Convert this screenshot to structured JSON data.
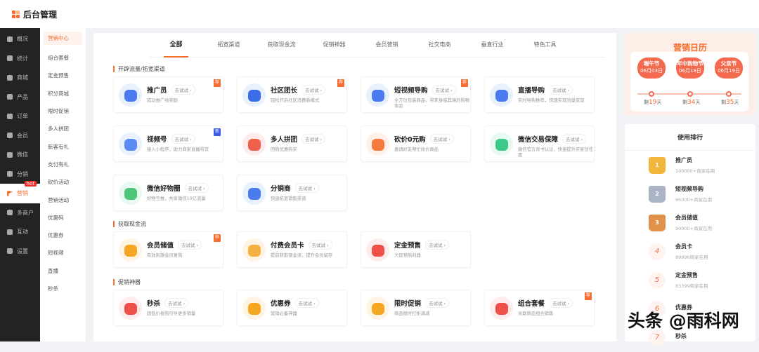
{
  "header": {
    "title": "后台管理"
  },
  "sidebar": [
    {
      "label": "概况"
    },
    {
      "label": "统计"
    },
    {
      "label": "商城"
    },
    {
      "label": "产品"
    },
    {
      "label": "订单"
    },
    {
      "label": "会员"
    },
    {
      "label": "微信"
    },
    {
      "label": "分销"
    },
    {
      "label": "营销",
      "badge": "hot"
    },
    {
      "label": "多商户"
    },
    {
      "label": "互动"
    },
    {
      "label": "设置"
    }
  ],
  "submenu": [
    "营销中心",
    "组合套餐",
    "定金预售",
    "积分商城",
    "限时促销",
    "多人拼团",
    "新客有礼",
    "支付有礼",
    "砍价活动",
    "营销活动",
    "优惠码",
    "优惠券",
    "短视频",
    "直播",
    "秒杀"
  ],
  "tabs": [
    "全部",
    "拓宽渠道",
    "获取现金流",
    "促销神器",
    "会员营销",
    "社交电商",
    "垂直行业",
    "特色工具"
  ],
  "try_label": "去试试 ›",
  "sections": [
    {
      "title": "开辟流量/拓宽渠道",
      "cards": [
        {
          "name": "推广员",
          "desc": "成功推广给奖励",
          "badge": "荐",
          "color": "#4a7cf0",
          "bg": "#eaf1fe"
        },
        {
          "name": "社区团长",
          "desc": "轻松开启社区消费新模式",
          "badge": "荐",
          "color": "#3a6ee8",
          "bg": "#eaf1fe"
        },
        {
          "name": "短视频导购",
          "desc": "全方位包装商品，带来身临其境的购物体验",
          "badge": "荐",
          "color": "#4a7cf0",
          "bg": "#eaf1fe"
        },
        {
          "name": "直播导购",
          "desc": "实时导购推荐，快速实现流量变现",
          "color": "#4a7cf0",
          "bg": "#eaf1fe"
        },
        {
          "name": "视频号",
          "desc": "接入小程序，助力商家直播带货",
          "badge": "新",
          "color": "#5b8bf5",
          "bg": "#eaf1fe"
        },
        {
          "name": "多人拼团",
          "desc": "团购优惠购买",
          "color": "#f0604a",
          "bg": "#feecec"
        },
        {
          "name": "砍价0元购",
          "desc": "邀请好友帮忙砍价商品",
          "color": "#f57a3c",
          "bg": "#fff0e8"
        },
        {
          "name": "微信交易保障",
          "desc": "微信官方背书认证，快速提升买家信任度",
          "color": "#3cc98a",
          "bg": "#e8f9f1"
        },
        {
          "name": "微信好物圈",
          "desc": "好物互推，共享微信10亿流量",
          "color": "#4cc77a",
          "bg": "#e8f9f1"
        },
        {
          "name": "分销商",
          "desc": "快速拓宽销售渠道",
          "color": "#4a7cf0",
          "bg": "#eaf1fe"
        }
      ]
    },
    {
      "title": "获取现金流",
      "cards": [
        {
          "name": "会员储值",
          "desc": "有效刺激会员复购",
          "badge": "荐",
          "color": "#f5a623",
          "bg": "#fff4e3"
        },
        {
          "name": "付费会员卡",
          "desc": "提前获取现金流，提升会员留存",
          "color": "#f5b041",
          "bg": "#fff4e3"
        },
        {
          "name": "定金预售",
          "desc": "大促预热利器",
          "color": "#f0504a",
          "bg": "#feecec"
        }
      ]
    },
    {
      "title": "促销神器",
      "cards": [
        {
          "name": "秒杀",
          "desc": "超低价抢购引导更多销量",
          "color": "#f0504a",
          "bg": "#feecec"
        },
        {
          "name": "优惠券",
          "desc": "营销必备神器",
          "color": "#f5a623",
          "bg": "#fff4e3"
        },
        {
          "name": "限时促销",
          "desc": "商品限时打折满减",
          "color": "#f5a623",
          "bg": "#fff4e3"
        },
        {
          "name": "组合套餐",
          "desc": "关联商品组合销售",
          "badge": "荐",
          "color": "#f0504a",
          "bg": "#feecec"
        }
      ]
    }
  ],
  "calendar": {
    "title": "营销日历",
    "festivals": [
      {
        "name": "端午节",
        "date": "06月03日",
        "prefix": "剩",
        "days": "19",
        "suffix": "天"
      },
      {
        "name": "年中购物节",
        "date": "06月18日",
        "prefix": "剩",
        "days": "34",
        "suffix": "天"
      },
      {
        "name": "父亲节",
        "date": "06月19日",
        "prefix": "剩",
        "days": "35",
        "suffix": "天"
      }
    ]
  },
  "ranking": {
    "title": "使用排行",
    "items": [
      {
        "rank": "1",
        "name": "推广员",
        "usage": "100000+商家在用",
        "color": "#f2b73a"
      },
      {
        "rank": "2",
        "name": "短视频导购",
        "usage": "95000+商家在用",
        "color": "#aab4c4"
      },
      {
        "rank": "3",
        "name": "会员储值",
        "usage": "90000+商家在用",
        "color": "#e0924a"
      },
      {
        "rank": "4",
        "name": "会员卡",
        "usage": "89898商家在用"
      },
      {
        "rank": "5",
        "name": "定金预售",
        "usage": "83399商家在用"
      },
      {
        "rank": "6",
        "name": "优惠券",
        "usage": ""
      },
      {
        "rank": "7",
        "name": "秒杀",
        "usage": ""
      }
    ]
  },
  "watermark": "头条 @雨科网"
}
